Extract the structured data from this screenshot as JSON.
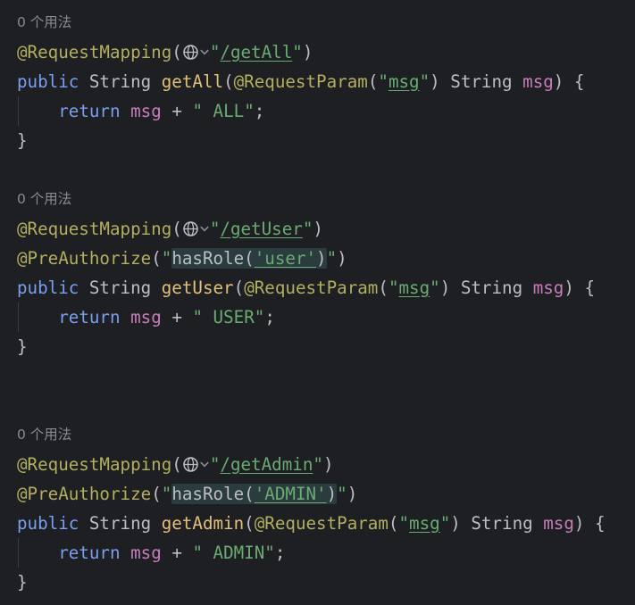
{
  "usage_hint": "0 个用法",
  "blocks": [
    {
      "mapping_annotation": "@RequestMapping",
      "path": "/getAll",
      "preauthorize": null,
      "signature": {
        "modifier": "public",
        "return_type": "String",
        "method_name": "getAll",
        "param_annotation": "@RequestParam",
        "param_key": "msg",
        "param_type": "String",
        "param_name": "msg"
      },
      "body": {
        "keyword": "return",
        "var": "msg",
        "op": "+",
        "literal": "\" ALL\""
      }
    },
    {
      "mapping_annotation": "@RequestMapping",
      "path": "/getUser",
      "preauthorize": {
        "annotation": "@PreAuthorize",
        "expr_fn": "hasRole(",
        "role": "'user'",
        "expr_close": ")"
      },
      "signature": {
        "modifier": "public",
        "return_type": "String",
        "method_name": "getUser",
        "param_annotation": "@RequestParam",
        "param_key": "msg",
        "param_type": "String",
        "param_name": "msg"
      },
      "body": {
        "keyword": "return",
        "var": "msg",
        "op": "+",
        "literal": "\" USER\""
      }
    },
    {
      "mapping_annotation": "@RequestMapping",
      "path": "/getAdmin",
      "preauthorize": {
        "annotation": "@PreAuthorize",
        "expr_fn": "hasRole(",
        "role": "'ADMIN'",
        "expr_close": ")"
      },
      "signature": {
        "modifier": "public",
        "return_type": "String",
        "method_name": "getAdmin",
        "param_annotation": "@RequestParam",
        "param_key": "msg",
        "param_type": "String",
        "param_name": "msg"
      },
      "body": {
        "keyword": "return",
        "var": "msg",
        "op": "+",
        "literal": "\" ADMIN\""
      }
    }
  ],
  "colors": {
    "background": "#1e1f22",
    "annotation": "#b3ae60",
    "keyword": "#7a9ef0",
    "method_name": "#56a8f5",
    "string": "#6aab73",
    "field": "#c77dbb",
    "spel_highlight": "#2b3c3f",
    "hint": "#868a91"
  },
  "icons": [
    "globe-icon",
    "chevron-down-icon"
  ]
}
